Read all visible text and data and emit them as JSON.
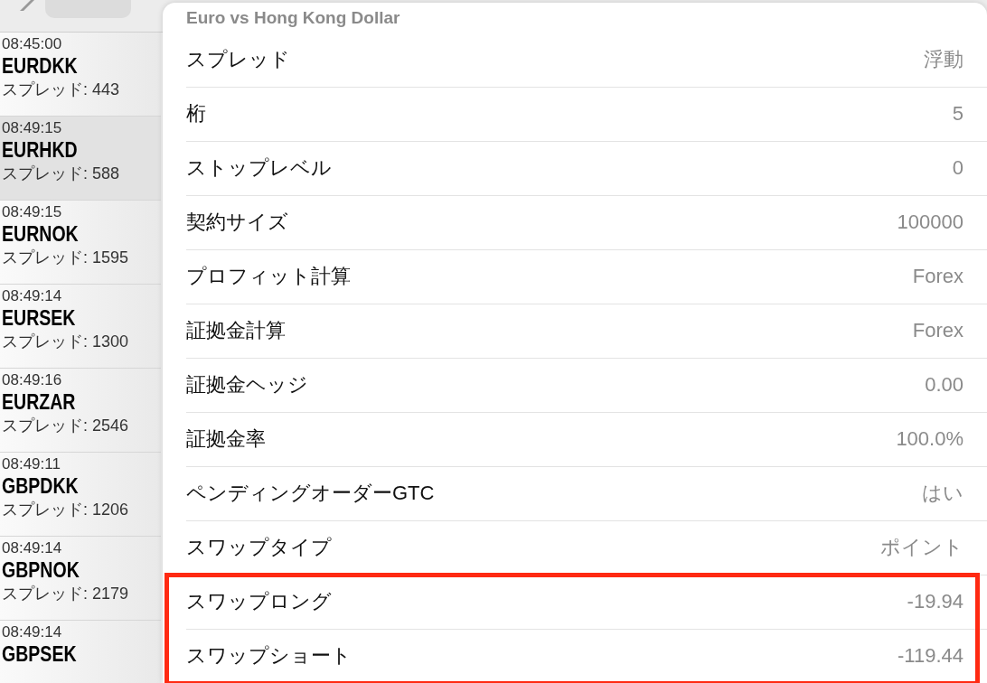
{
  "symbols": [
    {
      "time": "08:45:00",
      "name": "EURDKK",
      "spread": "スプレッド: 443",
      "selected": false
    },
    {
      "time": "08:49:15",
      "name": "EURHKD",
      "spread": "スプレッド: 588",
      "selected": true
    },
    {
      "time": "08:49:15",
      "name": "EURNOK",
      "spread": "スプレッド: 1595",
      "selected": false
    },
    {
      "time": "08:49:14",
      "name": "EURSEK",
      "spread": "スプレッド: 1300",
      "selected": false
    },
    {
      "time": "08:49:16",
      "name": "EURZAR",
      "spread": "スプレッド: 2546",
      "selected": false
    },
    {
      "time": "08:49:11",
      "name": "GBPDKK",
      "spread": "スプレッド: 1206",
      "selected": false
    },
    {
      "time": "08:49:14",
      "name": "GBPNOK",
      "spread": "スプレッド: 2179",
      "selected": false
    },
    {
      "time": "08:49:14",
      "name": "GBPSEK",
      "selected": false
    }
  ],
  "details": {
    "title": "Euro vs Hong Kong Dollar",
    "rows": [
      {
        "label": "スプレッド",
        "value": "浮動",
        "highlighted": false
      },
      {
        "label": "桁",
        "value": "5",
        "highlighted": false
      },
      {
        "label": "ストップレベル",
        "value": "0",
        "highlighted": false
      },
      {
        "label": "契約サイズ",
        "value": "100000",
        "highlighted": false
      },
      {
        "label": "プロフィット計算",
        "value": "Forex",
        "highlighted": false
      },
      {
        "label": "証拠金計算",
        "value": "Forex",
        "highlighted": false
      },
      {
        "label": "証拠金ヘッジ",
        "value": "0.00",
        "highlighted": false
      },
      {
        "label": "証拠金率",
        "value": "100.0%",
        "highlighted": false
      },
      {
        "label": "ペンディングオーダーGTC",
        "value": "はい",
        "highlighted": false
      },
      {
        "label": "スワップタイプ",
        "value": "ポイント",
        "highlighted": false
      },
      {
        "label": "スワップロング",
        "value": "-19.94",
        "highlighted": true
      },
      {
        "label": "スワップショート",
        "value": "-119.44",
        "highlighted": true
      }
    ]
  }
}
